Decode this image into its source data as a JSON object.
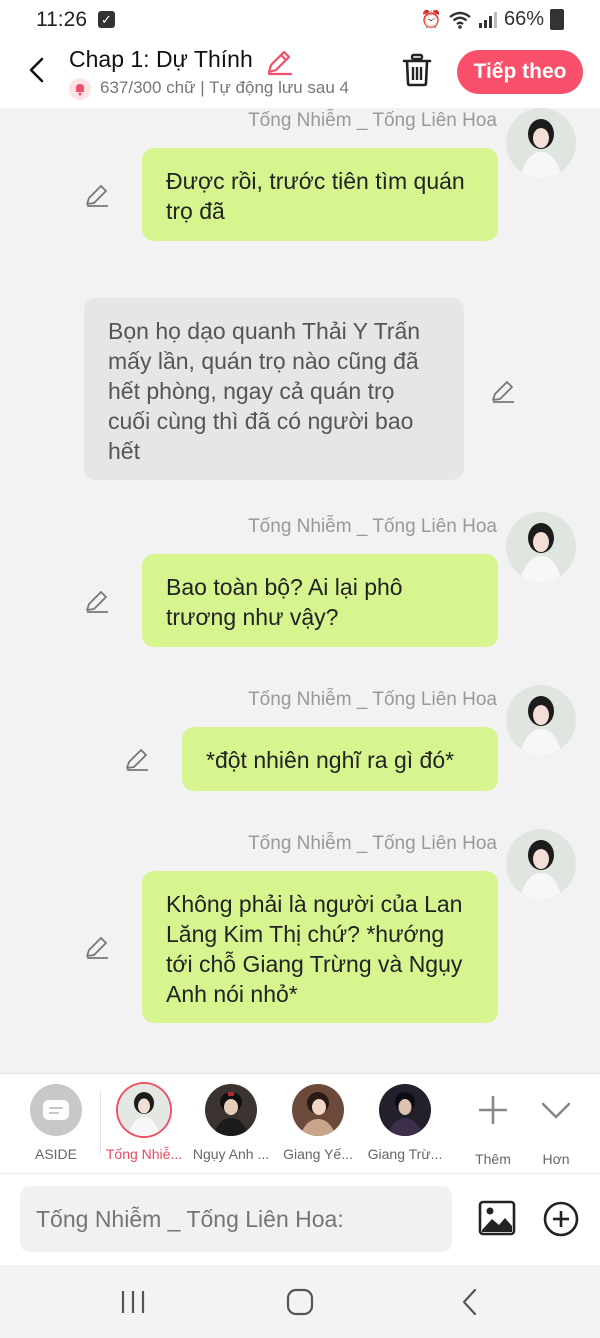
{
  "status_bar": {
    "time": "11:26",
    "battery": "66%"
  },
  "header": {
    "title": "Chap 1: Dự Thính",
    "word_count": "637/300 chữ | Tự động lưu sau 4",
    "next_label": "Tiếp theo"
  },
  "messages": [
    {
      "sender": "Tống Nhiễm _ Tống Liên Hoa",
      "text": "Được rồi, trước tiên tìm quán trọ đã"
    },
    {
      "sender": "",
      "text": "Bọn họ dạo quanh Thải Y Trấn mấy lần, quán trọ nào cũng đã hết phòng, ngay cả quán trọ cuối cùng thì đã có người bao hết"
    },
    {
      "sender": "Tống Nhiễm _ Tống Liên Hoa",
      "text": "Bao toàn bộ? Ai lại phô trương như vậy?"
    },
    {
      "sender": "Tống Nhiễm _ Tống Liên Hoa",
      "text": "*đột nhiên nghĩ ra gì đó*"
    },
    {
      "sender": "Tống Nhiễm _ Tống Liên Hoa",
      "text": "Không phải là người của Lan Lăng Kim Thị chứ? *hướng tới chỗ Giang Trừng và Ngụy Anh nói nhỏ*"
    }
  ],
  "characters": [
    {
      "name": "ASIDE"
    },
    {
      "name": "Tống Nhiễ..."
    },
    {
      "name": "Ngụy Anh ..."
    },
    {
      "name": "Giang Yế..."
    },
    {
      "name": "Giang Trừ..."
    }
  ],
  "char_actions": {
    "add": "Thêm",
    "more": "Hơn"
  },
  "input": {
    "placeholder": "Tống Nhiễm _ Tống Liên Hoa:"
  },
  "colors": {
    "accent": "#f8506a",
    "my_bubble": "#d6f58f",
    "other_bubble": "#e6e6e6"
  }
}
